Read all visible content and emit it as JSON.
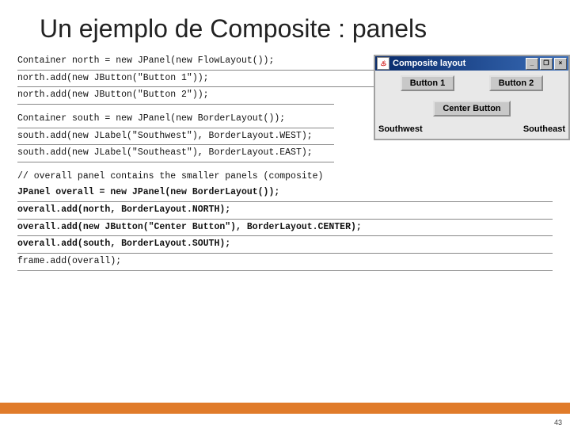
{
  "title": "Un ejemplo de Composite : panels",
  "code": {
    "l1": "Container north = new JPanel(new FlowLayout());",
    "l2": "north.add(new JButton(\"Button 1\"));",
    "l3": "north.add(new JButton(\"Button 2\"));",
    "l4": "Container south = new JPanel(new BorderLayout());",
    "l5": "south.add(new JLabel(\"Southwest\"), BorderLayout.WEST);",
    "l6": "south.add(new JLabel(\"Southeast\"), BorderLayout.EAST);",
    "l7": "// overall panel contains the smaller panels (composite)",
    "l8": "JPanel overall = new JPanel(new BorderLayout());",
    "l9": "overall.add(north, BorderLayout.NORTH);",
    "l10": "overall.add(new JButton(\"Center Button\"), BorderLayout.CENTER);",
    "l11": "overall.add(south, BorderLayout.SOUTH);",
    "l12": "frame.add(overall);"
  },
  "swing": {
    "title": "Composite layout",
    "java_glyph": "♨",
    "min": "_",
    "max": "❐",
    "close": "×",
    "button1": "Button 1",
    "button2": "Button 2",
    "center": "Center Button",
    "sw": "Southwest",
    "se": "Southeast"
  },
  "page": "43"
}
